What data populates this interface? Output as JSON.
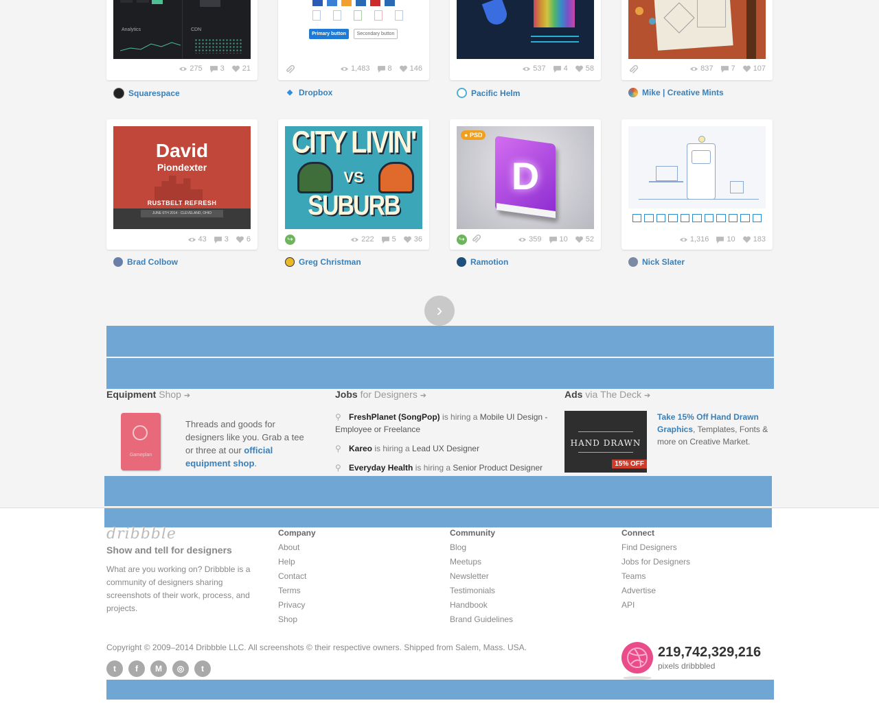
{
  "shots": [
    {
      "views": "275",
      "comments": "3",
      "likes": "21",
      "player": "Squarespace",
      "player_color": "#222222",
      "has_attachment": false,
      "has_rebound": false
    },
    {
      "views": "1,483",
      "comments": "8",
      "likes": "146",
      "player": "Dropbox",
      "player_color": "#2a8ae0",
      "has_attachment": true,
      "has_rebound": false,
      "primary_button": "Primary button",
      "secondary_button": "Secondary button"
    },
    {
      "views": "537",
      "comments": "4",
      "likes": "58",
      "player": "Pacific Helm",
      "player_color": "#4ab0d6",
      "has_attachment": false,
      "has_rebound": false
    },
    {
      "views": "837",
      "comments": "7",
      "likes": "107",
      "player": "Mike | Creative Mints",
      "player_color": "#d15a3a",
      "has_attachment": true,
      "has_rebound": false
    },
    {
      "views": "43",
      "comments": "3",
      "likes": "6",
      "player": "Brad Colbow",
      "player_color": "#6a7fa8",
      "has_attachment": false,
      "has_rebound": false,
      "title": "David",
      "subtitle": "Piondexter",
      "event": "RUSTBELT REFRESH",
      "event_date": "JUNE 6TH 2014 · CLEVELAND, OHIO"
    },
    {
      "views": "222",
      "comments": "5",
      "likes": "36",
      "player": "Greg Christman",
      "player_color": "#e8b82a",
      "has_attachment": false,
      "has_rebound": true,
      "line1": "CITY LIVIN'",
      "vs": "VS",
      "line2": "SUBURB LIVIN'"
    },
    {
      "views": "359",
      "comments": "10",
      "likes": "52",
      "player": "Ramotion",
      "player_color": "#1f4f7a",
      "has_attachment": true,
      "has_rebound": true,
      "badge": "PSD",
      "letter": "D"
    },
    {
      "views": "1,316",
      "comments": "10",
      "likes": "183",
      "player": "Nick Slater",
      "player_color": "#7a8aa5",
      "has_attachment": false,
      "has_rebound": false
    }
  ],
  "analytics_label": "Analytics",
  "cdn_label": "CDN",
  "equipment": {
    "title": "Equipment",
    "title_muted": "Shop",
    "text_before": "Threads and goods for designers like you. Grab a tee or three at our ",
    "link": "official equipment shop",
    "text_after": ".",
    "book_label": "Gameplan"
  },
  "jobs": {
    "title": "Jobs",
    "title_muted": "for Designers",
    "items": [
      {
        "company": "FreshPlanet (SongPop)",
        "hiring": " is hiring a ",
        "role": "Mobile UI Design - Employee or Freelance"
      },
      {
        "company": "Kareo",
        "hiring": " is hiring a ",
        "role": "Lead UX Designer"
      },
      {
        "company": "Everyday Health",
        "hiring": " is hiring a ",
        "role": "Senior Product Designer"
      }
    ]
  },
  "ads": {
    "title": "Ads",
    "title_via": "via",
    "title_link": "The Deck",
    "link": "Take 15% Off Hand Drawn Graphics",
    "rest": ", Templates, Fonts & more on Creative Market.",
    "img_title": "HAND DRAWN",
    "img_badge": "15% OFF"
  },
  "footer": {
    "logo": "dribbble",
    "tagline": "Show and tell for designers",
    "about": "What are you working on? Dribbble is a community of designers sharing screenshots of their work, process, and projects.",
    "company": {
      "head": "Company",
      "links": [
        "About",
        "Help",
        "Contact",
        "Terms",
        "Privacy",
        "Shop"
      ]
    },
    "community": {
      "head": "Community",
      "links": [
        "Blog",
        "Meetups",
        "Newsletter",
        "Testimonials",
        "Handbook",
        "Brand Guidelines"
      ]
    },
    "connect": {
      "head": "Connect",
      "links": [
        "Find Designers",
        "Jobs for Designers",
        "Teams",
        "Advertise",
        "API"
      ]
    },
    "copyright": "Copyright © 2009–2014 Dribbble LLC. All screenshots © their respective owners. Shipped from Salem, Mass. USA.",
    "pixels_count": "219,742,329,216",
    "pixels_label": "pixels dribbbled",
    "social": [
      {
        "name": "twitter-icon",
        "glyph": "t"
      },
      {
        "name": "facebook-icon",
        "glyph": "f"
      },
      {
        "name": "medium-icon",
        "glyph": "M"
      },
      {
        "name": "instagram-icon",
        "glyph": "◎"
      },
      {
        "name": "tumblr-icon",
        "glyph": "t"
      }
    ]
  },
  "colors": {
    "link": "#3a7fb7",
    "pink": "#ea4c89",
    "ad_band": "#6fa6d3"
  }
}
